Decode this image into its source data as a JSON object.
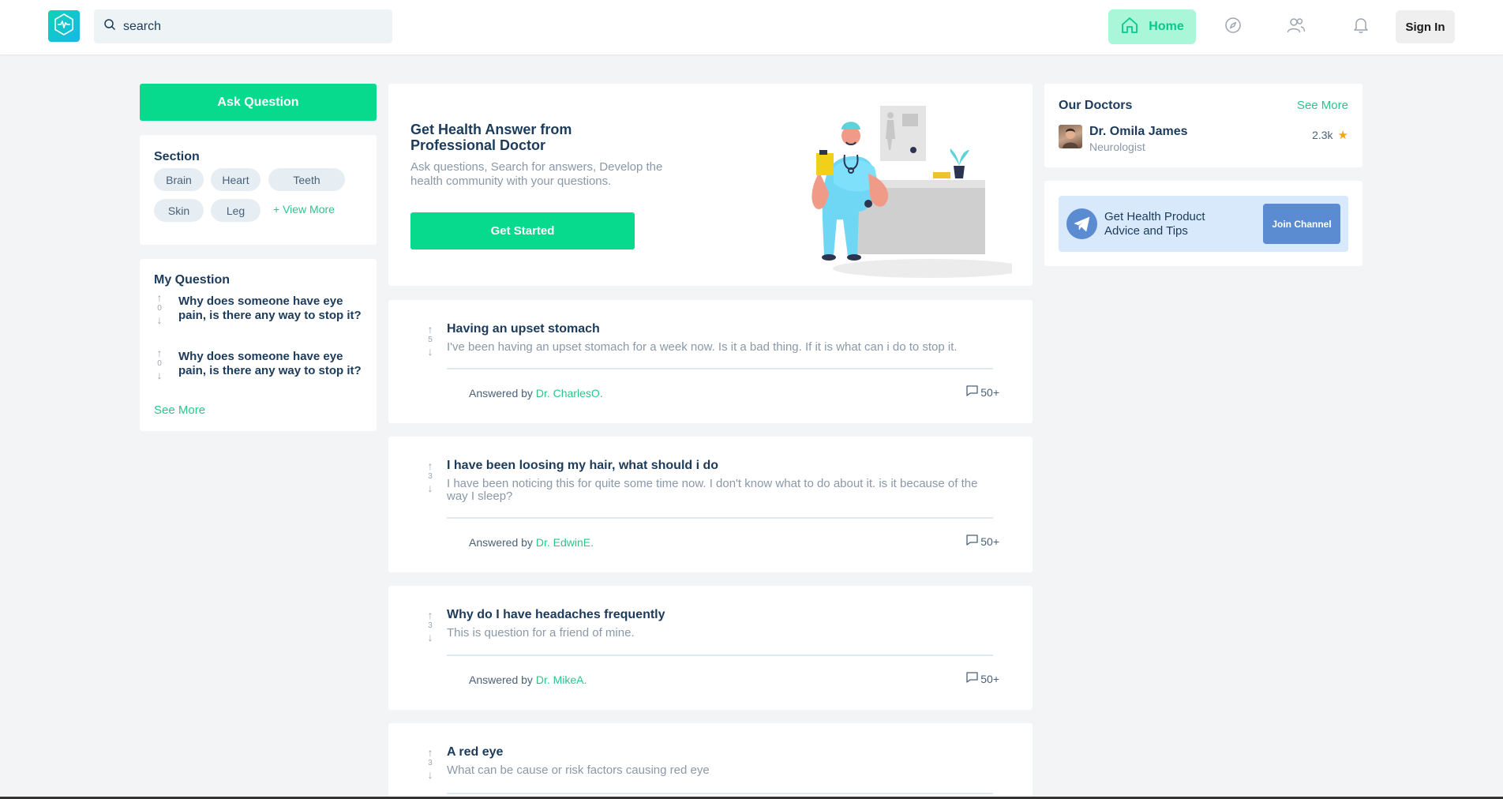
{
  "header": {
    "logo_icon": "heartbeat-hexagon-icon",
    "search_placeholder": "search",
    "nav": {
      "home_label": "Home"
    },
    "sign_in_label": "Sign In"
  },
  "sidebar": {
    "ask_button": "Ask Question",
    "section": {
      "title": "Section",
      "tags": [
        "Brain",
        "Heart",
        "Teeth",
        "Skin",
        "Leg"
      ],
      "view_more": "+ View More"
    },
    "my_question": {
      "title": "My Question",
      "items": [
        {
          "votes": "0",
          "text": "Why does someone have eye pain, is there any way to stop it?"
        },
        {
          "votes": "0",
          "text": "Why does someone have eye pain, is there any way to stop it?"
        }
      ],
      "see_more": "See More"
    }
  },
  "hero": {
    "title": "Get Health Answer from Professional Doctor",
    "subtitle": "Ask questions, Search for answers, Develop the health community with your questions.",
    "button": "Get Started"
  },
  "questions": [
    {
      "votes": "5",
      "title": "Having an upset stomach",
      "body": "I've been having an upset stomach for a week now. Is it a bad thing. If it is what can i do to stop it.",
      "answered_prefix": "Answered by ",
      "doctor": "Dr. CharlesO.",
      "comments": "50+"
    },
    {
      "votes": "3",
      "title": "I have been loosing my hair, what should i do",
      "body": "I have been noticing this for quite some time now. I don't know what to do about it. is it because of the way I sleep?",
      "answered_prefix": "Answered by ",
      "doctor": "Dr. EdwinE.",
      "comments": "50+"
    },
    {
      "votes": "3",
      "title": "Why do I have headaches frequently",
      "body": "This is question for a friend of mine.",
      "answered_prefix": "Answered by ",
      "doctor": "Dr. MikeA.",
      "comments": "50+"
    },
    {
      "votes": "3",
      "title": "A red eye",
      "body": "What can be cause or risk factors causing red eye"
    }
  ],
  "doctors": {
    "title": "Our Doctors",
    "see_more": "See More",
    "list": [
      {
        "name": "Dr. Omila James",
        "specialty": "Neurologist",
        "rating": "2.3k"
      }
    ]
  },
  "channel": {
    "text": "Get Health Product Advice and Tips",
    "button": "Join Channel"
  },
  "colors": {
    "accent": "#07d98d",
    "link": "#2bc58a",
    "text": "#1c3b5a",
    "muted": "#8a98a8",
    "channel": "#5b8bd0",
    "star": "#f7a600"
  }
}
